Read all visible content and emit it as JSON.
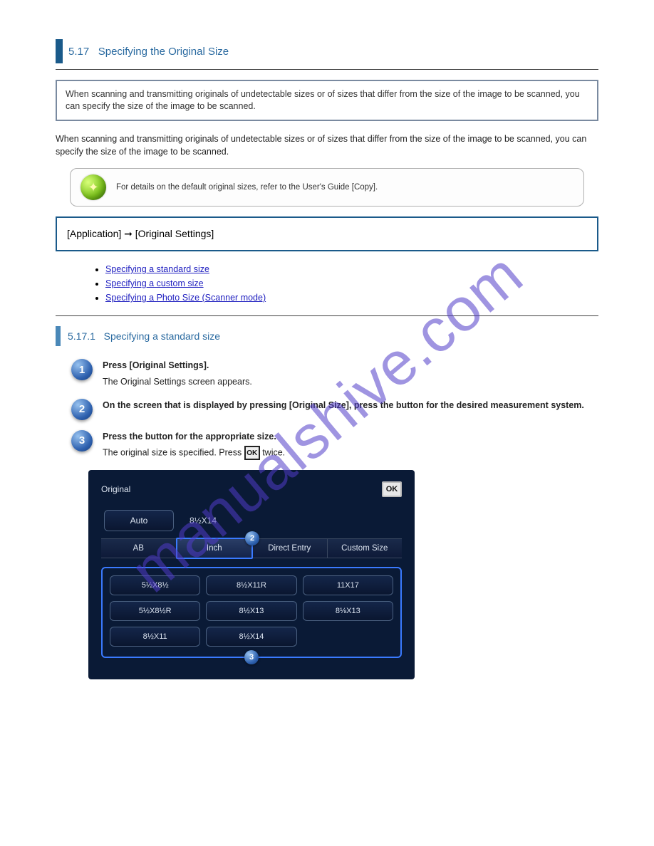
{
  "section": {
    "number": "5.17",
    "title": "Specifying the Original Size"
  },
  "graybox": "When scanning and transmitting originals of undetectable sizes or of sizes that differ from the size of the image to be scanned, you can specify the size of the image to be scanned.",
  "intro": "When scanning and transmitting originals of undetectable sizes or of sizes that differ from the size of the image to be scanned, you can specify the size of the image to be scanned.",
  "tip": "For details on the default original sizes, refer to the User's Guide [Copy].",
  "bluebox": "[Application] ➞ [Original Settings]",
  "links": [
    "Specifying a standard size",
    "Specifying a custom size",
    "Specifying a Photo Size (Scanner mode)"
  ],
  "subsection": {
    "number": "5.17.1",
    "title": "Specifying a standard size"
  },
  "steps": {
    "s1": {
      "lead": "Press [Original Settings].",
      "body": "The Original Settings screen appears."
    },
    "s2": {
      "lead": "On the screen that is displayed by pressing [Original Size], press the button for the desired measurement system."
    },
    "s3": {
      "lead": "Press the button for the appropriate size.",
      "body_before": "The original size is specified. Press ",
      "body_after": " twice."
    }
  },
  "ok_label": "OK",
  "panel": {
    "title": "Original",
    "ok": "OK",
    "auto": {
      "label": "Auto",
      "value": "8½X14"
    },
    "tabs": [
      "AB",
      "Inch",
      "Direct Entry",
      "Custom Size"
    ],
    "active_tab": 1,
    "sizes": [
      "5½X8½",
      "8½X11R",
      "11X17",
      "5½X8½R",
      "8½X13",
      "8⅛X13",
      "8½X11",
      "8½X14"
    ],
    "markers": {
      "tab": "2",
      "grid": "3"
    }
  },
  "watermark": "manualshive.com"
}
